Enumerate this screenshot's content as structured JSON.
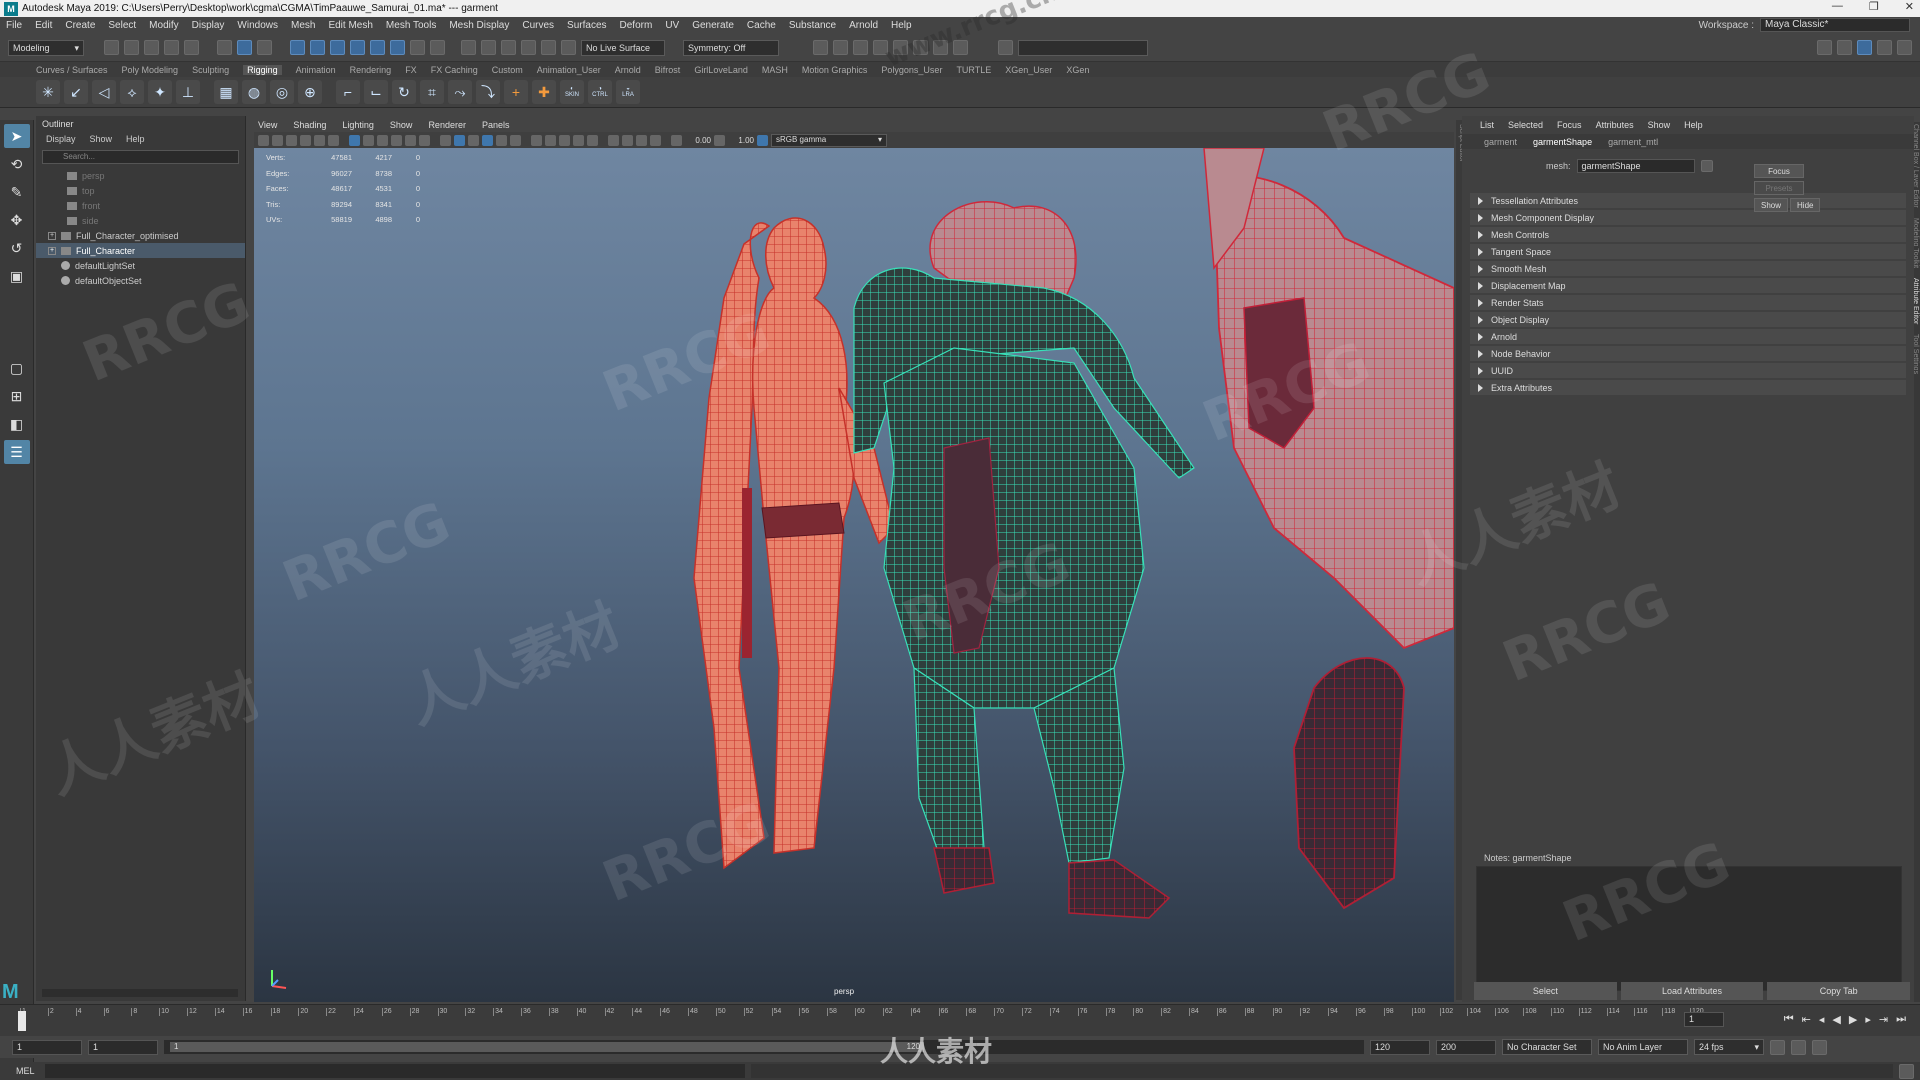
{
  "window": {
    "title": "Autodesk Maya 2019: C:\\Users\\Perry\\Desktop\\work\\cgma\\CGMA\\TimPaauwe_Samurai_01.ma*  ---  garment",
    "controls": [
      "—",
      "❐",
      "✕"
    ]
  },
  "menubar": [
    "File",
    "Edit",
    "Create",
    "Select",
    "Modify",
    "Display",
    "Windows",
    "Mesh",
    "Edit Mesh",
    "Mesh Tools",
    "Mesh Display",
    "Curves",
    "Surfaces",
    "Deform",
    "UV",
    "Generate",
    "Cache",
    "Substance",
    "Arnold",
    "Help"
  ],
  "workspace": {
    "label": "Workspace :",
    "value": "Maya Classic*"
  },
  "statusline": {
    "mode": "Modeling",
    "live_surface": "No Live Surface",
    "symmetry": "Symmetry: Off"
  },
  "shelf_tabs": [
    "Curves / Surfaces",
    "Poly Modeling",
    "Sculpting",
    "Rigging",
    "Animation",
    "Rendering",
    "FX",
    "FX Caching",
    "Custom",
    "Animation_User",
    "Arnold",
    "Bifrost",
    "GirlLoveLand",
    "MASH",
    "Motion Graphics",
    "Polygons_User",
    "TURTLE",
    "XGen_User",
    "XGen"
  ],
  "shelf_active": "Rigging",
  "shelf_labels": [
    "SKIN",
    "CTRL",
    "LRA"
  ],
  "outliner": {
    "title": "Outliner",
    "menu": [
      "Display",
      "Show",
      "Help"
    ],
    "search_placeholder": "Search...",
    "items": [
      "persp",
      "top",
      "front",
      "side",
      "Full_Character_optimised",
      "Full_Character",
      "defaultLightSet",
      "defaultObjectSet"
    ]
  },
  "viewport": {
    "menu": [
      "View",
      "Shading",
      "Lighting",
      "Show",
      "Renderer",
      "Panels"
    ],
    "toolbar": {
      "value_a": "0.00",
      "value_b": "1.00",
      "color_space": "sRGB gamma"
    },
    "hud": [
      {
        "label": "Verts:",
        "a": "47581",
        "b": "4217",
        "c": "0"
      },
      {
        "label": "Edges:",
        "a": "96027",
        "b": "8738",
        "c": "0"
      },
      {
        "label": "Faces:",
        "a": "48617",
        "b": "4531",
        "c": "0"
      },
      {
        "label": "Tris:",
        "a": "89294",
        "b": "8341",
        "c": "0"
      },
      {
        "label": "UVs:",
        "a": "58819",
        "b": "4898",
        "c": "0"
      }
    ],
    "camera": "persp"
  },
  "attribute_editor": {
    "menu": [
      "List",
      "Selected",
      "Focus",
      "Attributes",
      "Show",
      "Help"
    ],
    "tabs": [
      "garment",
      "garmentShape",
      "garment_mtl"
    ],
    "active_tab": "garmentShape",
    "mesh_label": "mesh:",
    "mesh_value": "garmentShape",
    "focus": "Focus",
    "presets": "Presets",
    "show": "Show",
    "hide": "Hide",
    "sections": [
      "Tessellation Attributes",
      "Mesh Component Display",
      "Mesh Controls",
      "Tangent Space",
      "Smooth Mesh",
      "Displacement Map",
      "Render Stats",
      "Object Display",
      "Arnold",
      "Node Behavior",
      "UUID",
      "Extra Attributes"
    ],
    "notes": "Notes:  garmentShape",
    "buttons": [
      "Select",
      "Load Attributes",
      "Copy Tab"
    ]
  },
  "side_tabs": [
    "Script Editor",
    "Channel Box / Layer Editor",
    "Modeling Toolkit",
    "Attribute Editor",
    "Tool Settings"
  ],
  "timeline": {
    "ticks": [
      "1",
      "2",
      "4",
      "6",
      "8",
      "10",
      "12",
      "14",
      "16",
      "18",
      "20",
      "22",
      "24",
      "26",
      "28",
      "30",
      "32",
      "34",
      "36",
      "38",
      "40",
      "42",
      "44",
      "46",
      "48",
      "50",
      "52",
      "54",
      "56",
      "58",
      "60",
      "62",
      "64",
      "66",
      "68",
      "70",
      "72",
      "74",
      "76",
      "78",
      "80",
      "82",
      "84",
      "86",
      "88",
      "90",
      "92",
      "94",
      "96",
      "98",
      "100",
      "102",
      "104",
      "106",
      "108",
      "110",
      "112",
      "114",
      "116",
      "118",
      "120"
    ],
    "current": "1"
  },
  "range": {
    "start": "1",
    "start2": "1",
    "range_start": "1",
    "range_end": "120",
    "end": "120",
    "end2": "200",
    "char_set": "No Character Set",
    "anim_layer": "No Anim Layer",
    "fps": "24 fps"
  },
  "cmdline": {
    "label": "MEL"
  },
  "watermark": {
    "top": "www.rrcg.cn",
    "bottom": "人人素材",
    "mark": "RRCG",
    "cn": "人人素材"
  },
  "colors": {
    "selection": "#5285a6",
    "viewport_top": "#6f86a1",
    "viewport_bottom": "#2b3542",
    "garment_wire": "#38e0b8",
    "body_wire": "#ff5a4a"
  }
}
